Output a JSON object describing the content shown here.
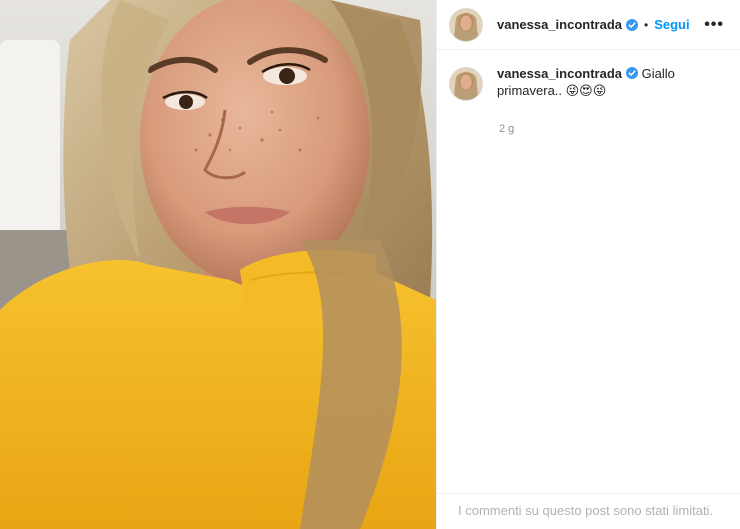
{
  "post": {
    "username": "vanessa_incontrada",
    "follow_label": "Segui",
    "dot": "•",
    "more_label": "•••",
    "caption_text": "Giallo primavera.. 😜😍😜",
    "time_ago": "2 g",
    "comments_limited": "I commenti su questo post sono stati limitati."
  },
  "colors": {
    "accent": "#0095f6",
    "verified": "#3897f0",
    "sweater": "#f2b21c",
    "muted_text": "#8e8e8e"
  },
  "icons": {
    "verified": "verified-badge-icon",
    "more": "more-options-icon"
  }
}
